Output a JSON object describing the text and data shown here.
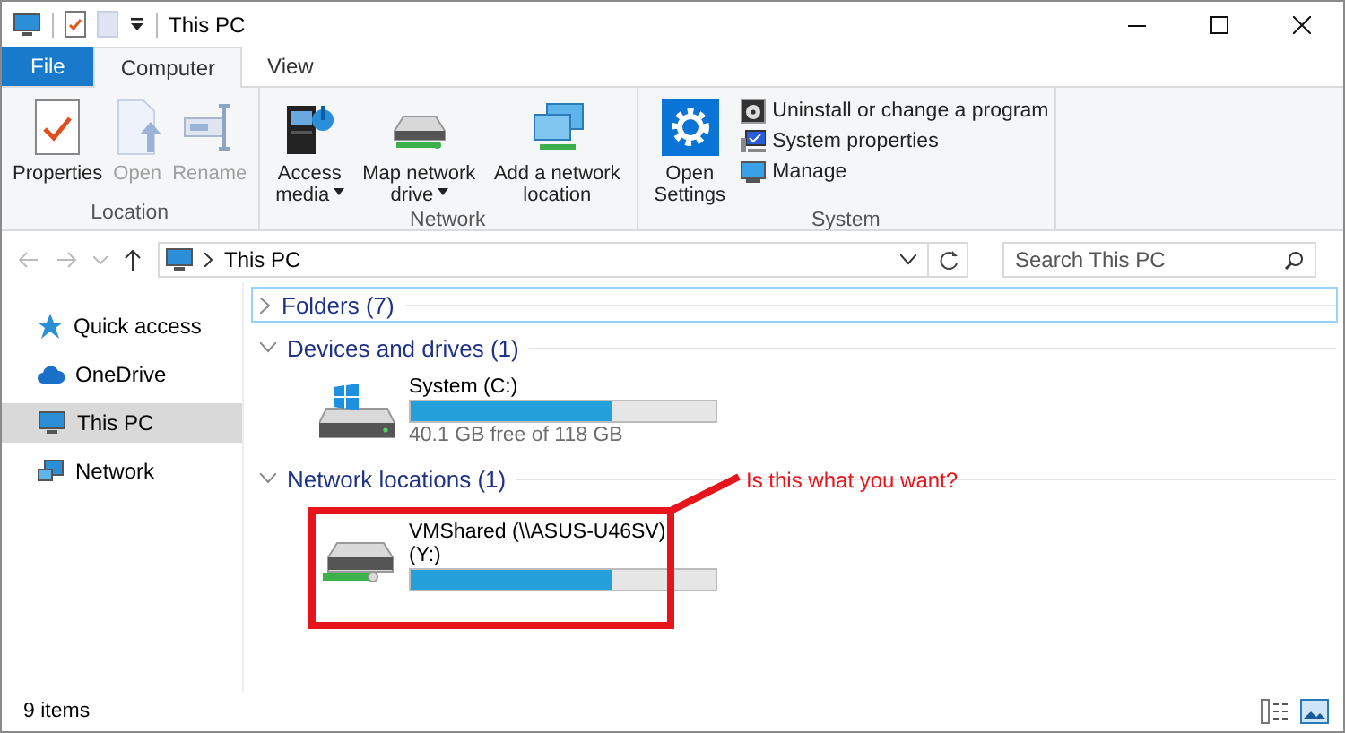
{
  "window": {
    "title": "This PC"
  },
  "ribbon_tabs": [
    {
      "label": "File",
      "kind": "file",
      "selected": false
    },
    {
      "label": "Computer",
      "kind": "tab",
      "selected": true
    },
    {
      "label": "View",
      "kind": "tab",
      "selected": false
    }
  ],
  "ribbon_groups": [
    {
      "name": "Location",
      "buttons": [
        {
          "label": "Properties",
          "disabled": false,
          "dropdown": false
        },
        {
          "label": "Open",
          "disabled": true,
          "dropdown": false
        },
        {
          "label": "Rename",
          "disabled": true,
          "dropdown": false
        }
      ]
    },
    {
      "name": "Network",
      "buttons": [
        {
          "label": "Access media",
          "disabled": false,
          "dropdown": true
        },
        {
          "label": "Map network drive",
          "disabled": false,
          "dropdown": true
        },
        {
          "label": "Add a network location",
          "disabled": false,
          "dropdown": false
        }
      ]
    },
    {
      "name": "System",
      "buttons": [
        {
          "label": "Open Settings",
          "disabled": false,
          "dropdown": false
        }
      ],
      "small_buttons": [
        {
          "label": "Uninstall or change a program"
        },
        {
          "label": "System properties"
        },
        {
          "label": "Manage"
        }
      ]
    }
  ],
  "address_bar": {
    "path": "This PC",
    "search_placeholder": "Search This PC"
  },
  "sidebar": {
    "items": [
      {
        "label": "Quick access",
        "selected": false
      },
      {
        "label": "OneDrive",
        "selected": false
      },
      {
        "label": "This PC",
        "selected": true
      },
      {
        "label": "Network",
        "selected": false
      }
    ]
  },
  "sections": [
    {
      "title": "Folders (7)",
      "expanded": false
    },
    {
      "title": "Devices and drives (1)",
      "expanded": true,
      "items": [
        {
          "name": "System (C:)",
          "kind": "local",
          "level": 0.66,
          "free": "40.1 GB free of 118 GB"
        }
      ]
    },
    {
      "title": "Network locations (1)",
      "expanded": true,
      "items": [
        {
          "name": "VMShared (\\\\ASUS-U46SV)",
          "letter": "(Y:)",
          "kind": "network",
          "level": 0.66
        }
      ]
    }
  ],
  "annotation": {
    "text": "Is this what you want?"
  },
  "status_bar": {
    "count": "9 items"
  }
}
